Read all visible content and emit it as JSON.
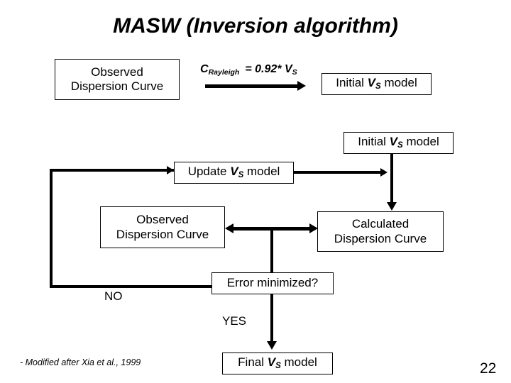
{
  "slide": {
    "title": "MASW (Inversion algorithm)",
    "page_number": "22",
    "footnote": "- Modified after Xia et al., 1999",
    "background_color": "#ffffff",
    "line_color": "#000000"
  },
  "formula": {
    "lhs": "C",
    "lhs_subscript": "Rayleigh",
    "operator": "=",
    "coefficient": "0.92*",
    "rhs": "V",
    "rhs_subscript": "S",
    "full_text": "C Rayleigh = 0.92* V S"
  },
  "boxes": {
    "observed_top": {
      "line1": "Observed",
      "line2": "Dispersion Curve"
    },
    "initial_model_top": {
      "prefix": "Initial ",
      "symbol": "V",
      "subscript": "S",
      "suffix": " model"
    },
    "initial_model_mid": {
      "prefix": "Initial ",
      "symbol": "V",
      "subscript": "S",
      "suffix": " model"
    },
    "update_model": {
      "prefix": "Update ",
      "symbol": "V",
      "subscript": "S",
      "suffix": " model"
    },
    "observed_mid": {
      "line1": "Observed",
      "line2": "Dispersion Curve"
    },
    "calculated_mid": {
      "line1": "Calculated",
      "line2": "Dispersion Curve"
    },
    "error_check": {
      "text": "Error  minimized?"
    },
    "final_model": {
      "prefix": "Final ",
      "symbol": "V",
      "subscript": "S",
      "suffix": " model"
    }
  },
  "labels": {
    "no_branch": "NO",
    "yes_branch": "YES"
  }
}
